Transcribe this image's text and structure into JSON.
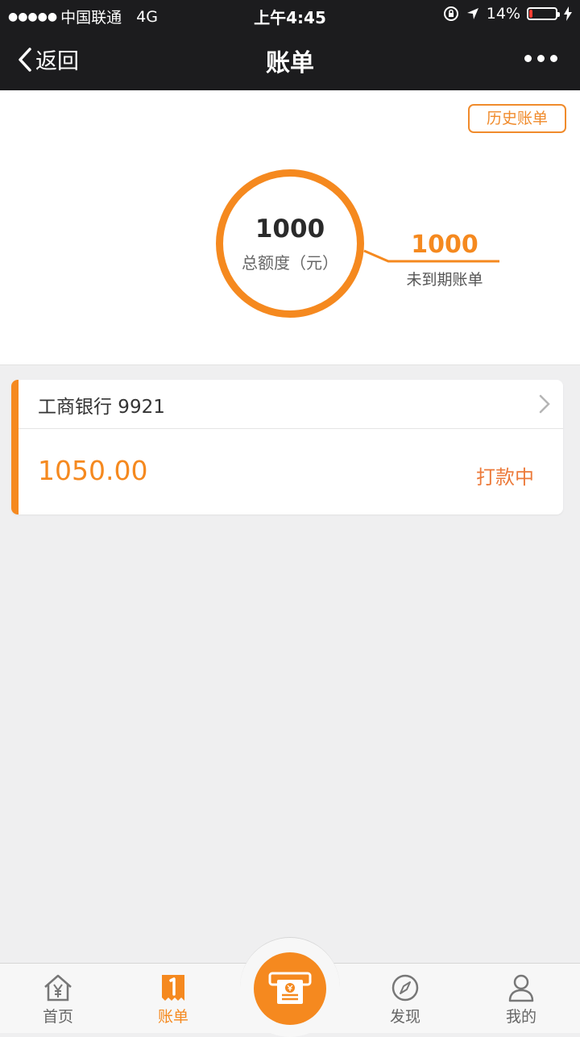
{
  "status_bar": {
    "signal_dots": "●●●●●",
    "carrier": "中国联通",
    "network": "4G",
    "time": "上午4:45",
    "battery": "14%",
    "battery_level": 0.14
  },
  "nav": {
    "back_label": "返回",
    "title": "账单"
  },
  "summary": {
    "history_button": "历史账单",
    "total_value": "1000",
    "total_label": "总额度（元）",
    "due_value": "1000",
    "due_label": "未到期账单"
  },
  "bill_card": {
    "bank": "工商银行 9921",
    "amount": "1050.00",
    "status": "打款中"
  },
  "tabs": [
    {
      "label": "首页",
      "icon": "home-yen-icon"
    },
    {
      "label": "账单",
      "icon": "bill-icon",
      "active": true
    },
    {
      "label": "",
      "icon": "cash-withdraw-icon"
    },
    {
      "label": "发现",
      "icon": "compass-icon"
    },
    {
      "label": "我的",
      "icon": "user-icon"
    }
  ],
  "colors": {
    "accent": "#f5891f",
    "status_text": "#ec7a3a",
    "bar_dark": "#1c1c1e"
  }
}
